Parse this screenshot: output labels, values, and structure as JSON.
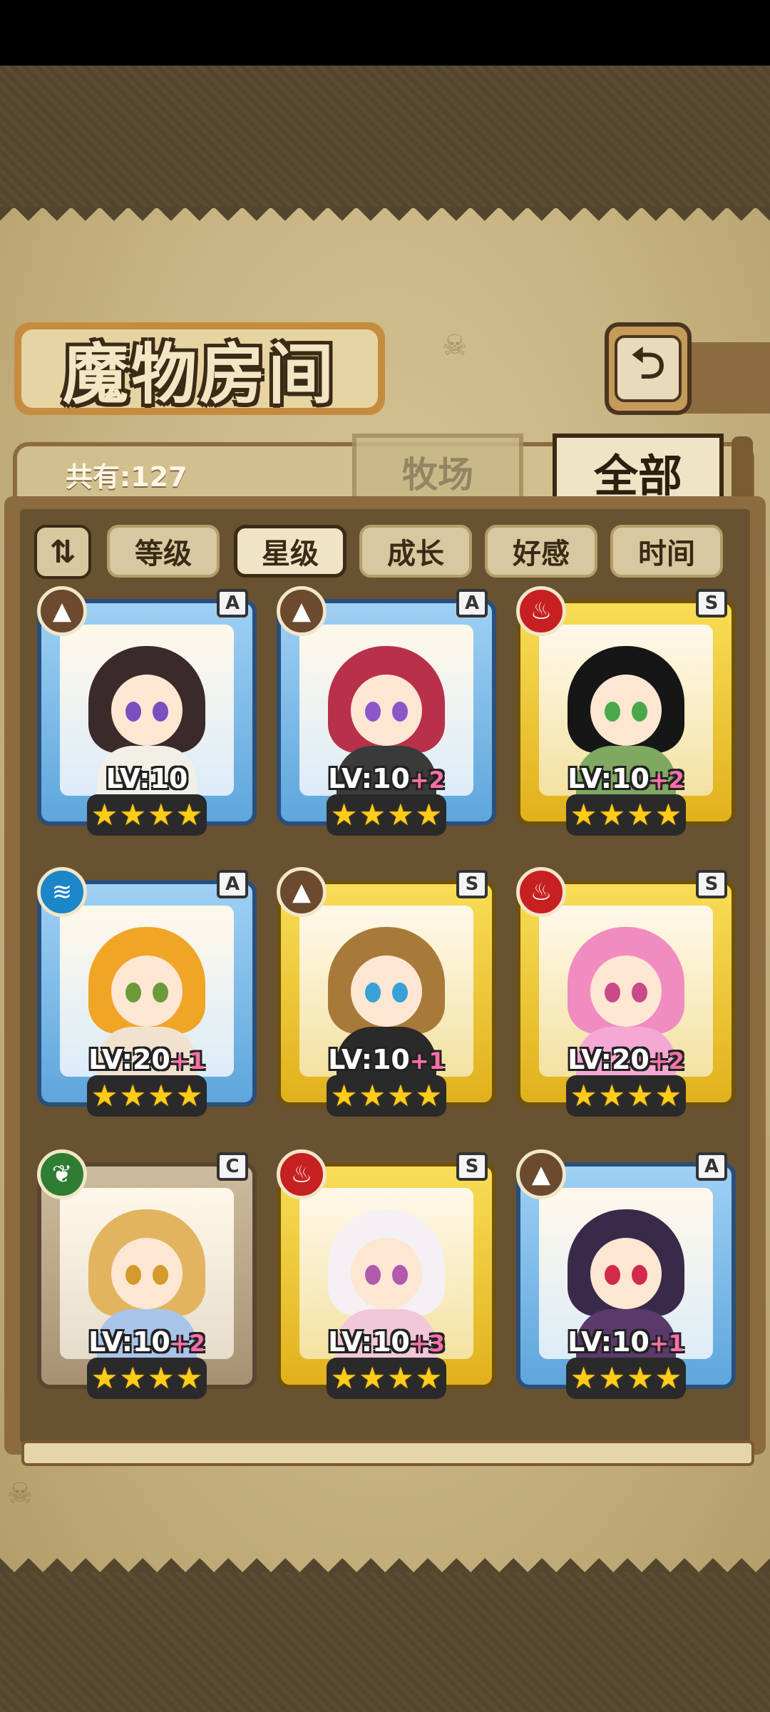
{
  "screen": {
    "title": "魔物房间",
    "back_icon": "return-arrow-icon",
    "count_label": "共有:127"
  },
  "tabs": [
    {
      "label": "牧场",
      "active": false
    },
    {
      "label": "全部",
      "active": true
    }
  ],
  "sort": {
    "toggle_icon": "sort-order-icon",
    "toggle_glyph": "⇅",
    "options": [
      {
        "label": "等级",
        "active": false
      },
      {
        "label": "星级",
        "active": true
      },
      {
        "label": "成长",
        "active": false
      },
      {
        "label": "好感",
        "active": false
      },
      {
        "label": "时间",
        "active": false
      }
    ]
  },
  "monsters": [
    {
      "rarity": "A",
      "element": "earth",
      "element_glyph": "▲",
      "level": "LV:10",
      "bonus": "",
      "stars": 4,
      "frame": "blue",
      "hair": "#3a2a2a",
      "eyes": "#7a4fbf",
      "outfit": "#f2efe6"
    },
    {
      "rarity": "A",
      "element": "earth",
      "element_glyph": "▲",
      "level": "LV:10",
      "bonus": "+2",
      "stars": 4,
      "frame": "blue",
      "hair": "#b8304a",
      "eyes": "#8b56c9",
      "outfit": "#3a3a3a"
    },
    {
      "rarity": "S",
      "element": "fire",
      "element_glyph": "♨",
      "level": "LV:10",
      "bonus": "+2",
      "stars": 4,
      "frame": "gold",
      "hair": "#161616",
      "eyes": "#4aa84a",
      "outfit": "#7fa860"
    },
    {
      "rarity": "A",
      "element": "water",
      "element_glyph": "≋",
      "level": "LV:20",
      "bonus": "+1",
      "stars": 4,
      "frame": "blue",
      "hair": "#f0a526",
      "eyes": "#6b9a3a",
      "outfit": "#f1e2d0"
    },
    {
      "rarity": "S",
      "element": "earth",
      "element_glyph": "▲",
      "level": "LV:10",
      "bonus": "+1",
      "stars": 4,
      "frame": "gold",
      "hair": "#a87a3a",
      "eyes": "#3aa0d8",
      "outfit": "#2a2a2a"
    },
    {
      "rarity": "S",
      "element": "fire",
      "element_glyph": "♨",
      "level": "LV:20",
      "bonus": "+2",
      "stars": 4,
      "frame": "gold",
      "hair": "#f08cc0",
      "eyes": "#c84a8a",
      "outfit": "#f5a8d4"
    },
    {
      "rarity": "C",
      "element": "wood",
      "element_glyph": "❦",
      "level": "LV:10",
      "bonus": "+2",
      "stars": 4,
      "frame": "gray",
      "hair": "#e2b460",
      "eyes": "#d49a2a",
      "outfit": "#a8c4e8"
    },
    {
      "rarity": "S",
      "element": "fire",
      "element_glyph": "♨",
      "level": "LV:10",
      "bonus": "+3",
      "stars": 4,
      "frame": "gold",
      "hair": "#f4f0f4",
      "eyes": "#b05ab0",
      "outfit": "#f0c8d8"
    },
    {
      "rarity": "A",
      "element": "earth",
      "element_glyph": "▲",
      "level": "LV:10",
      "bonus": "+1",
      "stars": 4,
      "frame": "blue",
      "hair": "#3a2a4a",
      "eyes": "#d22a4a",
      "outfit": "#5a3a6a"
    }
  ]
}
